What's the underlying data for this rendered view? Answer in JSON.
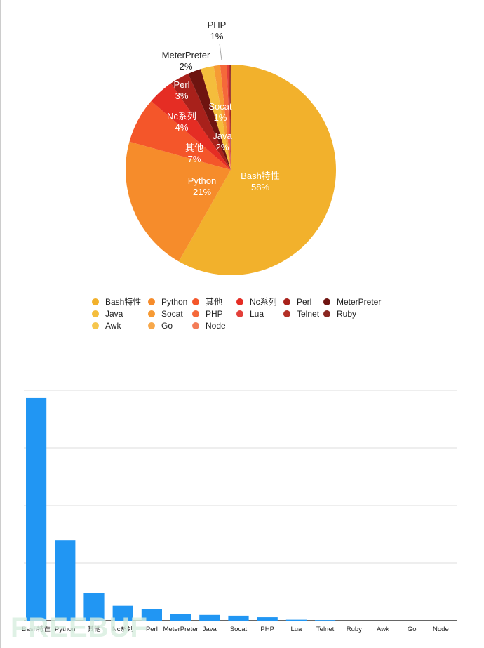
{
  "chart_data": [
    {
      "type": "pie",
      "slices": [
        {
          "name": "Bash特性",
          "value": 58,
          "label": "58%",
          "color": "#F2B12C"
        },
        {
          "name": "Python",
          "value": 21,
          "label": "21%",
          "color": "#F68C2B"
        },
        {
          "name": "其他",
          "value": 7,
          "label": "7%",
          "color": "#F4562A"
        },
        {
          "name": "Nc系列",
          "value": 4,
          "label": "4%",
          "color": "#E52D24"
        },
        {
          "name": "Perl",
          "value": 3,
          "label": "3%",
          "color": "#A8211B"
        },
        {
          "name": "MeterPreter",
          "value": 2,
          "label": "2%",
          "color": "#6E1410"
        },
        {
          "name": "Java",
          "value": 2,
          "label": "2%",
          "color": "#F4BD3C"
        },
        {
          "name": "Socat",
          "value": 1,
          "label": "1%",
          "color": "#F69A34"
        },
        {
          "name": "PHP",
          "value": 1,
          "label": "1%",
          "color": "#F5693A"
        },
        {
          "name": "Lua",
          "value": 0.3,
          "color": "#E3403A"
        },
        {
          "name": "Telnet",
          "value": 0.2,
          "color": "#B43026"
        },
        {
          "name": "Ruby",
          "value": 0.1,
          "color": "#8A2620"
        },
        {
          "name": "Awk",
          "value": 0,
          "color": "#F6C64D"
        },
        {
          "name": "Go",
          "value": 0,
          "color": "#F7A84B"
        },
        {
          "name": "Node",
          "value": 0,
          "color": "#F37C57"
        }
      ],
      "legend_placement": "bottom"
    },
    {
      "type": "bar",
      "categories": [
        "Bash特性",
        "Python",
        "其他",
        "Nc系列",
        "Perl",
        "MeterPreter",
        "Java",
        "Socat",
        "PHP",
        "Lua",
        "Telnet",
        "Ruby",
        "Awk",
        "Go",
        "Node"
      ],
      "values": [
        58,
        21,
        7.2,
        3.9,
        3,
        1.7,
        1.5,
        1.3,
        0.9,
        0.25,
        0.15,
        0,
        0,
        0,
        0
      ],
      "ylim": [
        0,
        60
      ],
      "grid": true,
      "color": "#2196F3"
    }
  ],
  "watermark": "FREEBUF"
}
